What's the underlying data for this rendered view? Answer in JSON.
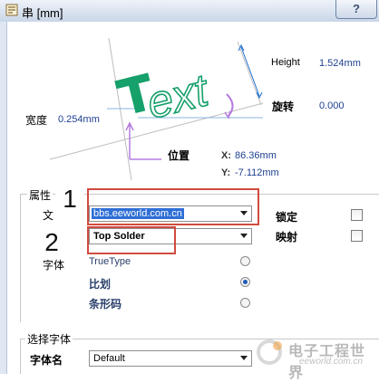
{
  "window": {
    "title": "串 [mm]",
    "help_label": "?"
  },
  "preview": {
    "sample_text": "Text",
    "height_label": "Height",
    "height_value": "1.524mm",
    "width_label": "宽度",
    "width_value": "0.254mm",
    "rotation_label": "旋转",
    "rotation_value": "0.000",
    "position_label": "位置",
    "x_label": "X:",
    "x_value": "86.36mm",
    "y_label": "Y:",
    "y_value": "-7.112mm"
  },
  "properties": {
    "section_title": "属性",
    "text_label": "文",
    "text_value": "bbs.eeworld.com.cn",
    "layer_value": "Top Solder",
    "lock_label": "锁定",
    "mirror_label": "映射",
    "font_type_label": "字体",
    "font_options": [
      {
        "label": "TrueType",
        "checked": false
      },
      {
        "label": "比划",
        "checked": true
      },
      {
        "label": "条形码",
        "checked": false
      }
    ]
  },
  "font_section": {
    "title": "选择字体",
    "font_name_label": "字体名",
    "font_name_value": "Default"
  },
  "callouts": {
    "one": "1",
    "two": "2"
  },
  "watermark": {
    "line1": "电子工程世界",
    "line2": "eeworld.com.cn"
  },
  "colors": {
    "accent_green": "#16a06a",
    "value_blue": "#1c3f8f",
    "highlight_red": "#d14b3f"
  }
}
